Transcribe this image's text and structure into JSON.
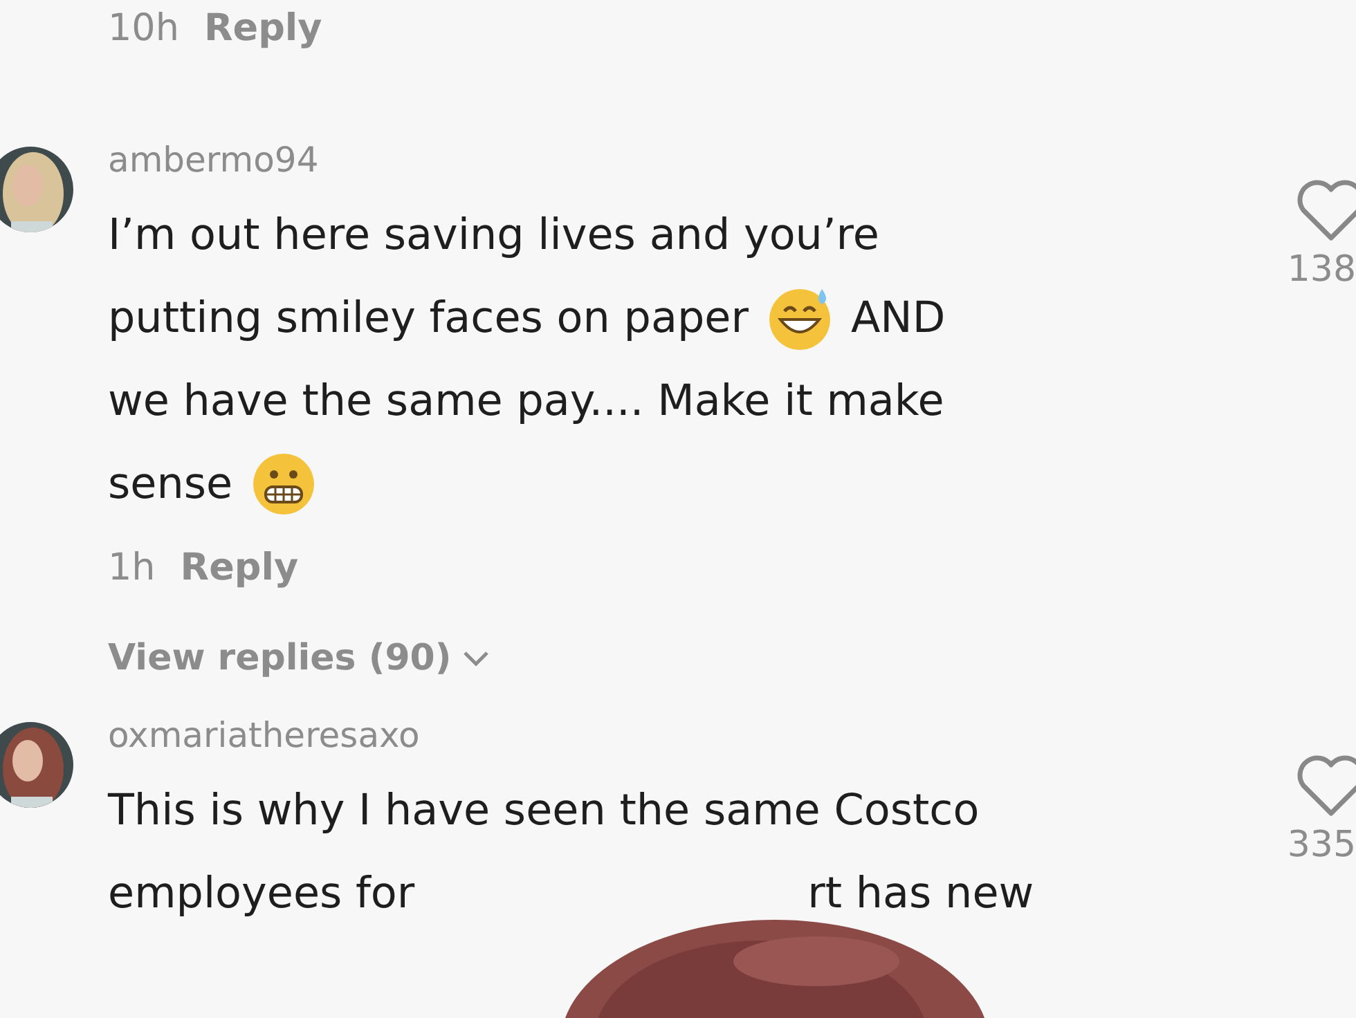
{
  "previous_comment": {
    "time": "10h",
    "reply": "Reply"
  },
  "comments": [
    {
      "username": "ambermo94",
      "likes": "138",
      "lines": [
        [
          {
            "kind": "text",
            "text": "I’m out here saving lives and you’re"
          }
        ],
        [
          {
            "kind": "text",
            "text": "putting smiley faces on paper"
          },
          {
            "kind": "sweat-smile"
          },
          {
            "kind": "text",
            "text": "AND"
          }
        ],
        [
          {
            "kind": "text",
            "text": "we have the same pay.... Make it make"
          }
        ],
        [
          {
            "kind": "text",
            "text": "sense"
          },
          {
            "kind": "grimace"
          }
        ]
      ],
      "time": "1h",
      "reply": "Reply",
      "view_replies": "View replies (90)"
    },
    {
      "username": "oxmariatheresaxo",
      "likes": "335",
      "lines": [
        [
          {
            "kind": "text",
            "text": "This is why I have seen the same Costco"
          }
        ],
        [
          {
            "kind": "text",
            "text": "employees for"
          },
          {
            "kind": "gap"
          },
          {
            "kind": "text",
            "text": "rt has new"
          }
        ]
      ]
    }
  ]
}
